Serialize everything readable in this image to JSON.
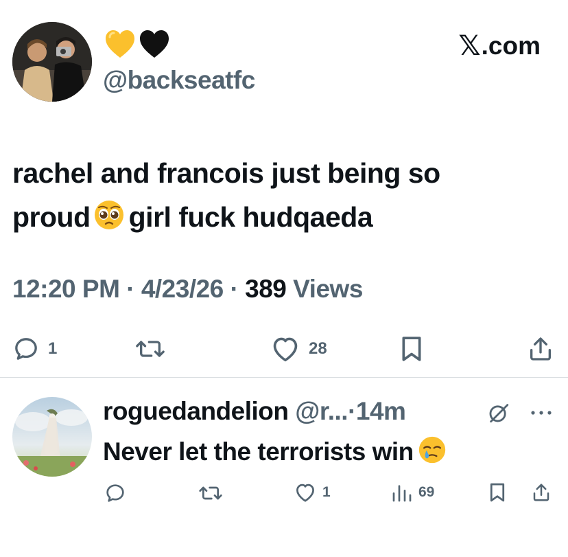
{
  "post": {
    "header_emoji": [
      "yellow-heart",
      "black-heart"
    ],
    "handle": "@backseatfc",
    "brand": "X.com",
    "text_line1": "rachel and francois just being so",
    "text_line2_a": "proud",
    "text_line2_b": "girl fuck hudqaeda",
    "text_emoji": "pleading-face",
    "time": "12:20 PM",
    "date": "4/23/26",
    "separator": "·",
    "views_count": "389",
    "views_label": "Views",
    "replies": "1",
    "likes": "28"
  },
  "reply": {
    "name": "roguedandelion",
    "handle": "@r...",
    "separator": "·",
    "age": "14m",
    "text": "Never let the terrorists win",
    "text_emoji": "face-holding-back-tears",
    "likes": "1",
    "views": "69"
  },
  "colors": {
    "text": "#0f1419",
    "secondary": "#536471",
    "divider": "#d9dde1"
  }
}
